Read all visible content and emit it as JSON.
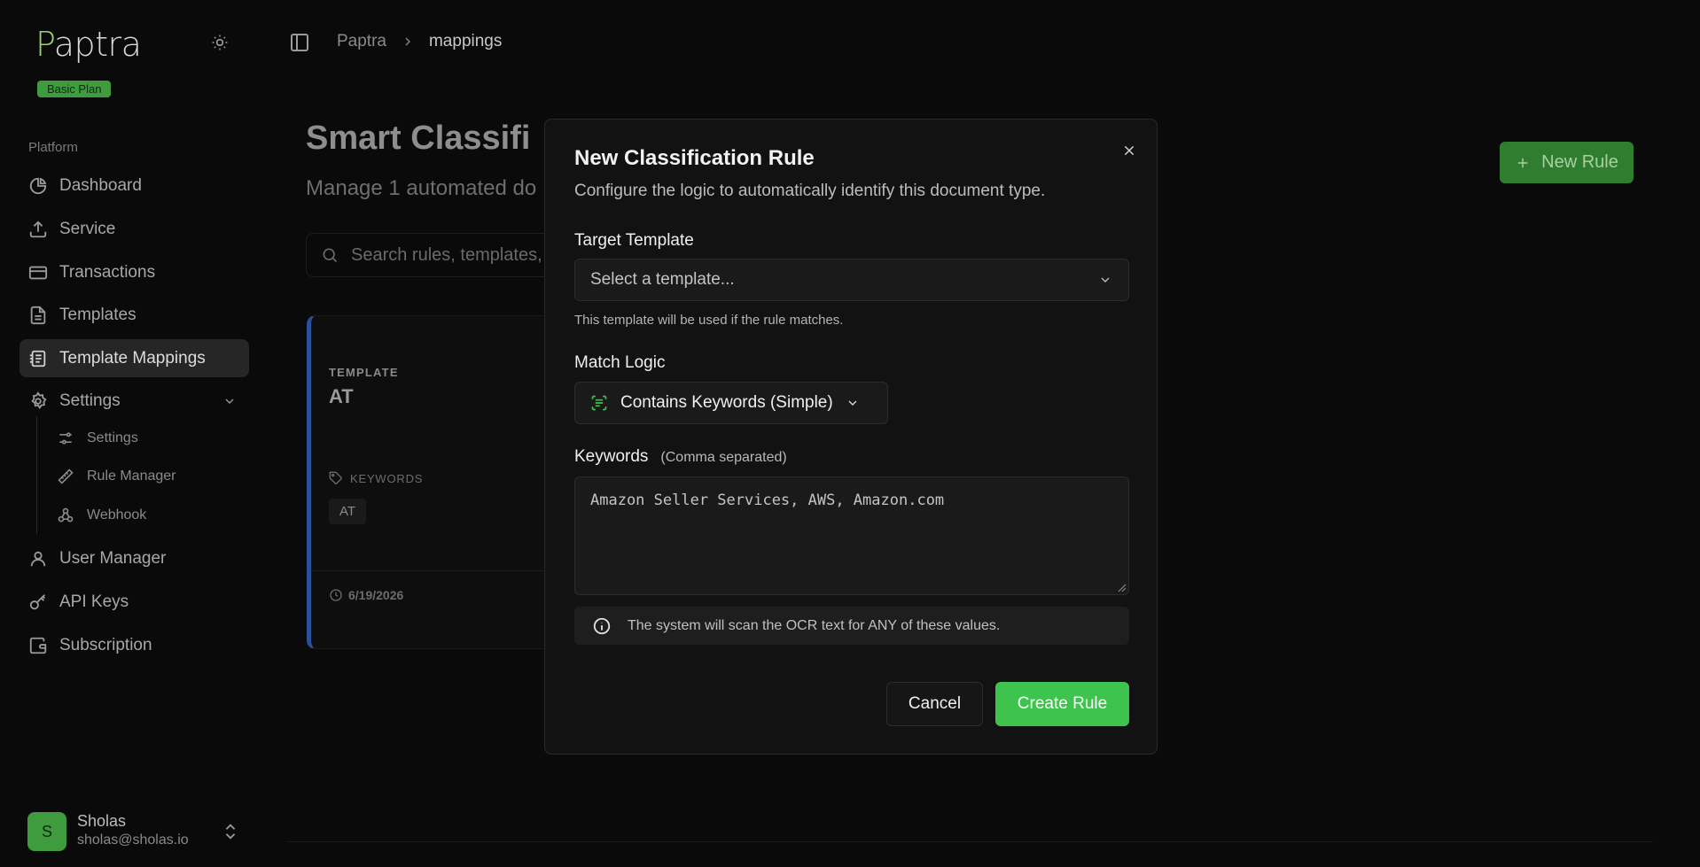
{
  "sidebar": {
    "logo": "aptra",
    "logo_initial": "P",
    "plan": "Basic Plan",
    "section": "Platform",
    "items": [
      {
        "label": "Dashboard",
        "icon": "pie-chart-icon"
      },
      {
        "label": "Service",
        "icon": "upload-icon"
      },
      {
        "label": "Transactions",
        "icon": "credit-card-icon"
      },
      {
        "label": "Templates",
        "icon": "file-text-icon"
      },
      {
        "label": "Template Mappings",
        "icon": "mapping-icon"
      },
      {
        "label": "Settings",
        "icon": "gear-icon"
      }
    ],
    "sub_items": [
      {
        "label": "Settings",
        "icon": "sliders-icon"
      },
      {
        "label": "Rule Manager",
        "icon": "ruler-icon"
      },
      {
        "label": "Webhook",
        "icon": "webhook-icon"
      }
    ],
    "items_bottom": [
      {
        "label": "User Manager",
        "icon": "user-icon"
      },
      {
        "label": "API Keys",
        "icon": "key-icon"
      },
      {
        "label": "Subscription",
        "icon": "wallet-icon"
      }
    ],
    "user": {
      "initial": "S",
      "name": "Sholas",
      "email": "sholas@sholas.io"
    }
  },
  "breadcrumb": {
    "root": "Paptra",
    "current": "mappings"
  },
  "main": {
    "title": "Smart Classifi",
    "subtitle": "Manage 1 automated do",
    "search_placeholder": "Search rules, templates,",
    "new_rule": "New Rule",
    "card": {
      "label": "TEMPLATE",
      "title": "AT",
      "keywords_label": "KEYWORDS",
      "keyword": "AT",
      "date": "6/19/2026"
    }
  },
  "modal": {
    "title": "New Classification Rule",
    "subtitle": "Configure the logic to automatically identify this document type.",
    "target_label": "Target Template",
    "target_placeholder": "Select a template...",
    "target_hint": "This template will be used if the rule matches.",
    "logic_label": "Match Logic",
    "logic_value": "Contains Keywords (Simple)",
    "keywords_label": "Keywords",
    "keywords_note": "(Comma separated)",
    "keywords_value": "Amazon Seller Services, AWS, Amazon.com",
    "info": "The system will scan the OCR text for ANY of these values.",
    "cancel": "Cancel",
    "create": "Create Rule"
  },
  "colors": {
    "accent": "#3fc34f",
    "background": "#0a0a0a",
    "card_border": "#2c4f9a"
  }
}
